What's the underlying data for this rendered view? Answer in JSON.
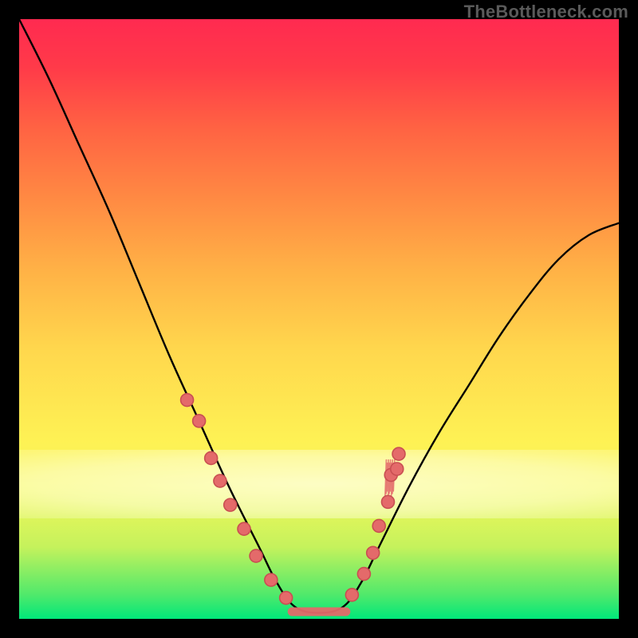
{
  "watermark": "TheBottleneck.com",
  "colors": {
    "dot": "#e46a6a",
    "dot_stroke": "#c94f52",
    "curve": "#000000"
  },
  "chart_data": {
    "type": "line",
    "title": "",
    "xlabel": "",
    "ylabel": "",
    "xlim": [
      0,
      1
    ],
    "ylim": [
      0,
      1
    ],
    "note": "Values normalized (no axis tick labels visible). Higher y = worse (red); lower y = better (green). Curve is a V / bottleneck shape.",
    "series": [
      {
        "name": "bottleneck-curve",
        "x": [
          0.0,
          0.05,
          0.1,
          0.15,
          0.2,
          0.25,
          0.3,
          0.35,
          0.4,
          0.43,
          0.46,
          0.5,
          0.54,
          0.57,
          0.6,
          0.65,
          0.7,
          0.75,
          0.8,
          0.85,
          0.9,
          0.95,
          1.0
        ],
        "y": [
          1.0,
          0.9,
          0.79,
          0.68,
          0.56,
          0.44,
          0.33,
          0.22,
          0.12,
          0.06,
          0.02,
          0.01,
          0.02,
          0.06,
          0.12,
          0.22,
          0.31,
          0.39,
          0.47,
          0.54,
          0.6,
          0.64,
          0.66
        ]
      }
    ],
    "marker_clusters": [
      {
        "name": "left-arm-dots",
        "points": [
          {
            "x": 0.28,
            "y": 0.365
          },
          {
            "x": 0.3,
            "y": 0.33
          },
          {
            "x": 0.32,
            "y": 0.268
          },
          {
            "x": 0.335,
            "y": 0.23
          },
          {
            "x": 0.352,
            "y": 0.19
          },
          {
            "x": 0.375,
            "y": 0.15
          },
          {
            "x": 0.395,
            "y": 0.105
          },
          {
            "x": 0.42,
            "y": 0.065
          },
          {
            "x": 0.445,
            "y": 0.035
          }
        ]
      },
      {
        "name": "right-arm-dots",
        "points": [
          {
            "x": 0.555,
            "y": 0.04
          },
          {
            "x": 0.575,
            "y": 0.075
          },
          {
            "x": 0.59,
            "y": 0.11
          },
          {
            "x": 0.6,
            "y": 0.155
          },
          {
            "x": 0.615,
            "y": 0.195
          },
          {
            "x": 0.62,
            "y": 0.24
          },
          {
            "x": 0.63,
            "y": 0.25
          },
          {
            "x": 0.633,
            "y": 0.275
          }
        ]
      }
    ],
    "flat_segment": {
      "x0": 0.455,
      "x1": 0.545,
      "y": 0.012
    },
    "right_fuzz": {
      "x": 0.618,
      "y0": 0.205,
      "y1": 0.265,
      "n": 9
    }
  }
}
